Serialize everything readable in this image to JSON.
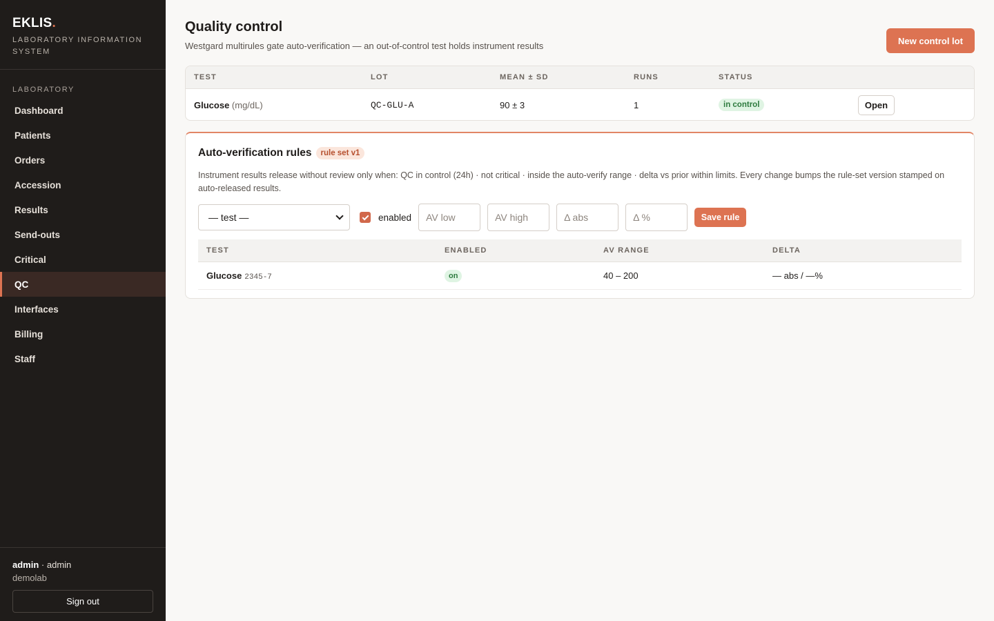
{
  "brand": {
    "name": "EKLIS",
    "dot": ".",
    "tagline": "Laboratory Information System"
  },
  "nav": {
    "section": "Laboratory",
    "items": [
      {
        "label": "Dashboard"
      },
      {
        "label": "Patients"
      },
      {
        "label": "Orders"
      },
      {
        "label": "Accession"
      },
      {
        "label": "Results"
      },
      {
        "label": "Send-outs"
      },
      {
        "label": "Critical"
      },
      {
        "label": "QC",
        "active": true
      },
      {
        "label": "Interfaces"
      },
      {
        "label": "Billing"
      },
      {
        "label": "Staff"
      }
    ]
  },
  "user": {
    "name": "admin",
    "role_sep": " · ",
    "role": "admin",
    "org": "demolab",
    "signout_label": "Sign out"
  },
  "page": {
    "title": "Quality control",
    "subtitle": "Westgard multirules gate auto-verification — an out-of-control test holds instrument results",
    "new_lot_label": "New control lot"
  },
  "qc_table": {
    "headers": {
      "test": "Test",
      "lot": "Lot",
      "mean_sd": "Mean ± SD",
      "runs": "Runs",
      "status": "Status"
    },
    "rows": [
      {
        "test": "Glucose",
        "unit": "(mg/dL)",
        "lot": "QC-GLU-A",
        "mean_sd": "90 ± 3",
        "runs": "1",
        "status": "in control",
        "action": "Open"
      }
    ]
  },
  "rules": {
    "title": "Auto-verification rules",
    "version_badge": "rule set v1",
    "description": "Instrument results release without review only when: QC in control (24h) · not critical · inside the auto-verify range · delta vs prior within limits. Every change bumps the rule-set version stamped on auto-released results.",
    "form": {
      "test_select": "— test —",
      "enabled_label": "enabled",
      "enabled_checked": true,
      "av_low_placeholder": "AV low",
      "av_high_placeholder": "AV high",
      "delta_abs_placeholder": "Δ abs",
      "delta_pct_placeholder": "Δ %",
      "save_label": "Save rule"
    },
    "table": {
      "headers": {
        "test": "Test",
        "enabled": "Enabled",
        "av_range": "AV range",
        "delta": "Delta"
      },
      "rows": [
        {
          "test": "Glucose",
          "code": "2345-7",
          "enabled": "on",
          "av_range": "40 – 200",
          "delta": "— abs / —%"
        }
      ]
    }
  },
  "colors": {
    "accent": "#dd7352",
    "sidebar_bg": "#1f1c1a",
    "success_bg": "#dff4e3",
    "success_fg": "#2d7a3e"
  }
}
